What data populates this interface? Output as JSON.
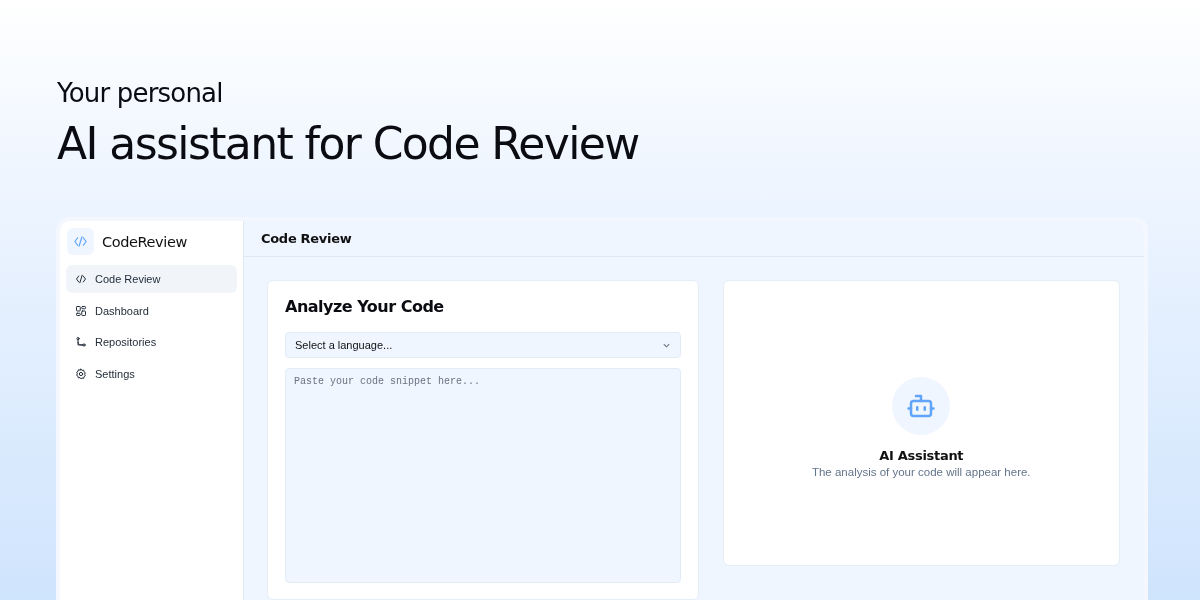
{
  "hero": {
    "eyebrow": "Your personal",
    "title": "AI assistant for Code Review"
  },
  "sidebar": {
    "brand": "CodeReview",
    "items": [
      {
        "label": "Code Review",
        "kind": "code",
        "selected": true
      },
      {
        "label": "Dashboard",
        "kind": "dashboard",
        "selected": false
      },
      {
        "label": "Repositories",
        "kind": "repo",
        "selected": false
      },
      {
        "label": "Settings",
        "kind": "settings",
        "selected": false
      }
    ]
  },
  "header": {
    "title": "Code Review"
  },
  "analyze_card": {
    "title": "Analyze Your Code",
    "language_select": {
      "placeholder": "Select a language..."
    },
    "code_input": {
      "placeholder": "Paste your code snippet here..."
    }
  },
  "result_card": {
    "title": "AI Assistant",
    "message": "The analysis of your code will appear here."
  }
}
